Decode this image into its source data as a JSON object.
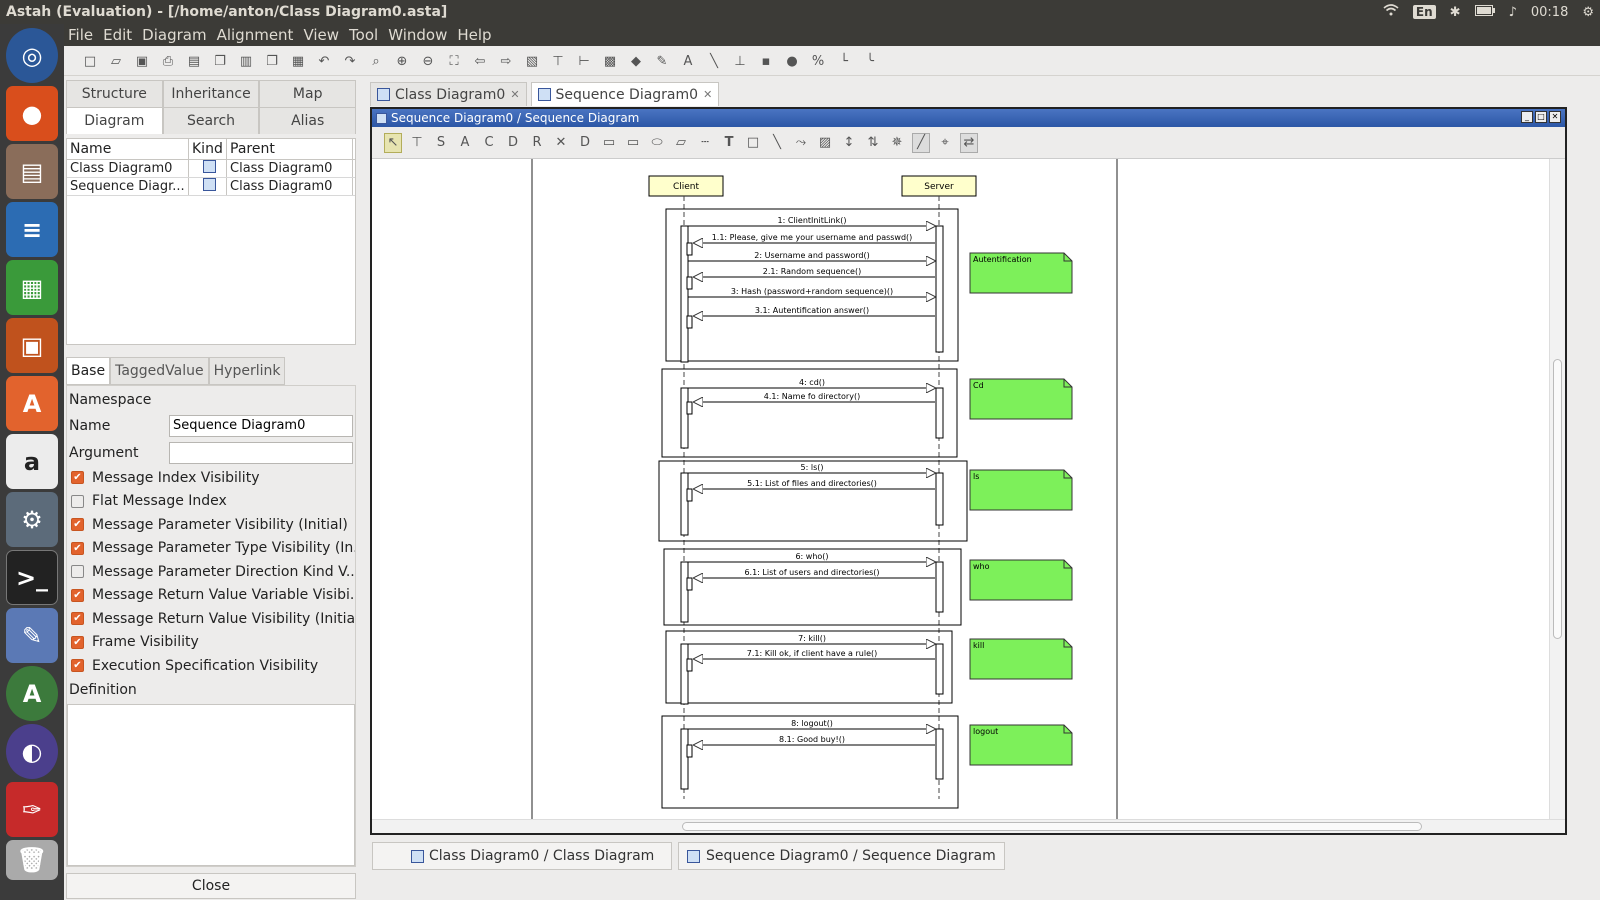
{
  "window": {
    "title": "Astah (Evaluation) - [/home/anton/Class Diagram0.asta]"
  },
  "system_tray": {
    "lang": "En",
    "clock": "00:18"
  },
  "menu": [
    "File",
    "Edit",
    "Diagram",
    "Alignment",
    "View",
    "Tool",
    "Window",
    "Help"
  ],
  "left_panel": {
    "tabs_row1": [
      "Structure",
      "Inheritance",
      "Map"
    ],
    "tabs_row2": [
      "Diagram",
      "Search",
      "Alias"
    ],
    "tree_headers": {
      "name": "Name",
      "kind": "Kind",
      "parent": "Parent"
    },
    "tree_rows": [
      {
        "name": "Class Diagram0",
        "parent": "Class Diagram0"
      },
      {
        "name": "Sequence Diagr...",
        "parent": "Class Diagram0"
      }
    ],
    "prop_tabs": [
      "Base",
      "TaggedValue",
      "Hyperlink"
    ],
    "namespace_label": "Namespace",
    "name_label": "Name",
    "name_value": "Sequence Diagram0",
    "argument_label": "Argument",
    "argument_value": "",
    "checks": [
      {
        "label": "Message Index Visibility",
        "checked": true
      },
      {
        "label": "Flat Message Index",
        "checked": false
      },
      {
        "label": "Message Parameter Visibility (Initial)",
        "checked": true
      },
      {
        "label": "Message Parameter Type Visibility (In...",
        "checked": true
      },
      {
        "label": "Message Parameter Direction Kind V...",
        "checked": false
      },
      {
        "label": "Message Return Value Variable Visibi...",
        "checked": true
      },
      {
        "label": "Message Return Value Visibility (Initial)",
        "checked": true
      },
      {
        "label": "Frame Visibility",
        "checked": true
      },
      {
        "label": "Execution Specification Visibility",
        "checked": true
      }
    ],
    "definition_label": "Definition",
    "close_label": "Close"
  },
  "doc_tabs": [
    "Class Diagram0",
    "Sequence Diagram0"
  ],
  "diagram_frame_title": "Sequence Diagram0 / Sequence Diagram",
  "diagram": {
    "lifelines": [
      "Client",
      "Server"
    ],
    "messages": [
      "1: ClientInitLink()",
      "1.1: Please, give me your username and passwd()",
      "2: Username and password()",
      "2.1: Random sequence()",
      "3: Hash (password+random sequence)()",
      "3.1: Autentification answer()",
      "4: cd()",
      "4.1: Name fo directory()",
      "5: ls()",
      "5.1: List of files and directories()",
      "6: who()",
      "6.1: List of users and directories()",
      "7: kill()",
      "7.1: Kill ok, if client have a rule()",
      "8: logout()",
      "8.1: Good buy!()"
    ],
    "notes": [
      "Autentification",
      "Cd",
      "ls",
      "who",
      "kill",
      "logout"
    ]
  },
  "bottom_tabs": [
    "Class Diagram0 / Class Diagram",
    "Sequence Diagram0 / Sequence Diagram"
  ],
  "colors": {
    "note_fill": "#7df05a",
    "accent_check": "#e2632d",
    "frame_title": "#2c57a6"
  }
}
